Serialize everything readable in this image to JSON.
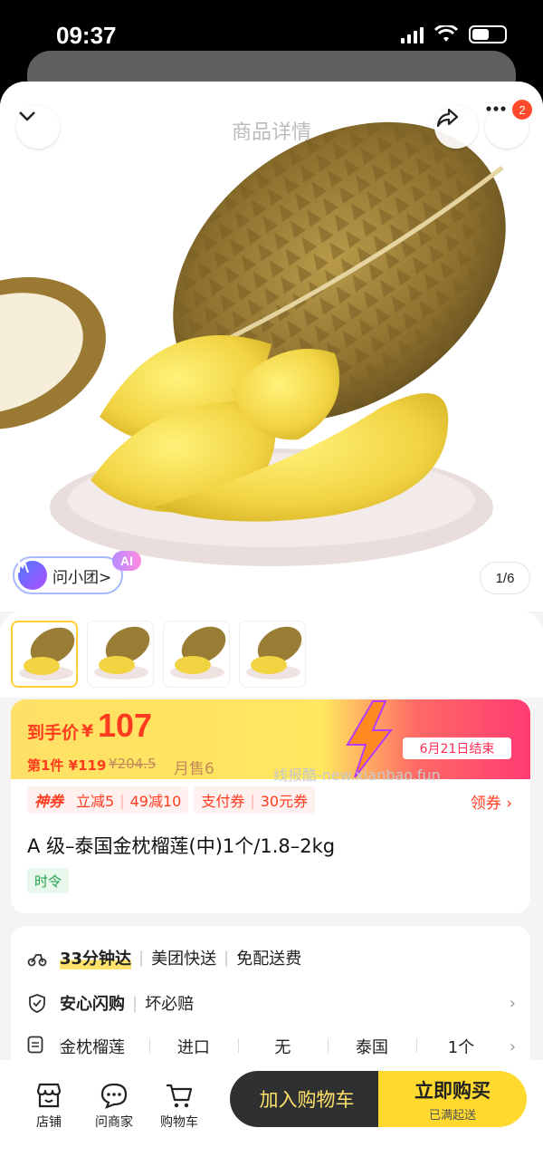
{
  "status": {
    "time": "09:37"
  },
  "nav": {
    "title": "商品详情",
    "badge_count": "2"
  },
  "hero": {
    "ask_label": "问小团>",
    "ai_badge": "AI",
    "page_indicator": "1/6"
  },
  "price": {
    "label": "到手价",
    "currency": "¥",
    "value": "107",
    "first_price": "第1件 ¥119",
    "original_price": "¥204.5",
    "monthly_sales": "月售6",
    "end_date": "6月21日结束",
    "watermark": "线报酷-new.xianbao.fun"
  },
  "coupons": {
    "shenquan": "神券",
    "discount1": "立减5",
    "discount2": "49减10",
    "pay_coupon": "支付券",
    "pay_amount": "30元券",
    "get": "领券 ›"
  },
  "product": {
    "title": "A 级–泰国金枕榴莲(中)1个/1.8–2kg",
    "tag": "时令"
  },
  "delivery": {
    "time": "33分钟达",
    "service": "美团快送",
    "fee": "免配送费",
    "guarantee": "安心闪购",
    "guarantee_sub": "坏必赔"
  },
  "specs": [
    "金枕榴莲",
    "进口",
    "无",
    "泰国",
    "1个"
  ],
  "bottom": {
    "store": "店铺",
    "ask_merchant": "问商家",
    "cart": "购物车",
    "add_cart": "加入购物车",
    "buy_now": "立即购买",
    "buy_sub": "已满起送"
  },
  "colors": {
    "accent": "#ff3b1f",
    "buy_yellow": "#ffd92e",
    "dark": "#2f3032"
  }
}
